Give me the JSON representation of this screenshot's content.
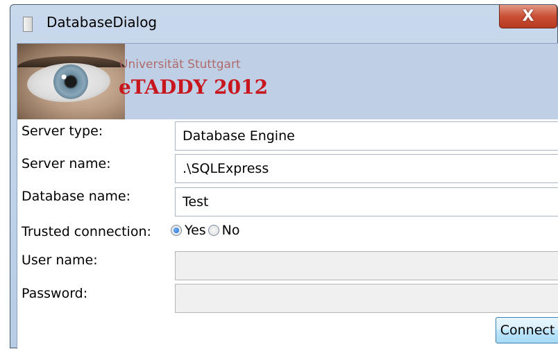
{
  "window": {
    "title": "DatabaseDialog",
    "close_glyph": "X"
  },
  "banner": {
    "university": "Universität Stuttgart",
    "brand": "eTADDY 2012"
  },
  "form": {
    "server_type": {
      "label": "Server type:",
      "value": "Database Engine"
    },
    "server_name": {
      "label": "Server name:",
      "value": ".\\SQLExpress"
    },
    "database_name": {
      "label": "Database name:",
      "value": "Test"
    },
    "trusted_connection": {
      "label": "Trusted connection:",
      "options": [
        {
          "label": "Yes",
          "selected": true
        },
        {
          "label": "No",
          "selected": false
        }
      ]
    },
    "user_name": {
      "label": "User name:",
      "value": ""
    },
    "password": {
      "label": "Password:",
      "value": ""
    }
  },
  "actions": {
    "connect_label": "Connect"
  },
  "colors": {
    "brand_red": "#c8161e",
    "title_bar": "#c9d9ec",
    "close_button": "#c94f36"
  }
}
